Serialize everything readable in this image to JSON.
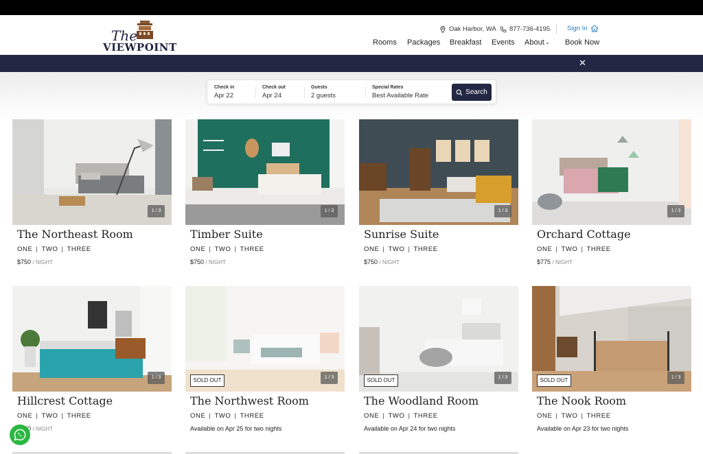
{
  "brand": {
    "script": "The",
    "name": "VIEWPOINT"
  },
  "utility": {
    "location": "Oak Harbor, WA",
    "phone": "877-736-4195",
    "signin": "Sign In"
  },
  "nav": {
    "items": [
      "Rooms",
      "Packages",
      "Breakfast",
      "Events",
      "About",
      "Book Now"
    ]
  },
  "search": {
    "checkin_label": "Check in",
    "checkin_value": "Apr 22",
    "checkout_label": "Check out",
    "checkout_value": "Apr 24",
    "guests_label": "Guests",
    "guests_value": "2 guests",
    "rates_label": "Special Rates",
    "rates_value": "Best Available Rate",
    "button": "Search"
  },
  "rooms": [
    {
      "title": "The Northeast Room",
      "opt1": "ONE",
      "opt2": "TWO",
      "opt3": "THREE",
      "price": "$750",
      "unit": "/ NIGHT",
      "counter": "1 / 3"
    },
    {
      "title": "Timber Suite",
      "opt1": "ONE",
      "opt2": "TWO",
      "opt3": "THREE",
      "price": "$750",
      "unit": "/ NIGHT",
      "counter": "1 / 3"
    },
    {
      "title": "Sunrise Suite",
      "opt1": "ONE",
      "opt2": "TWO",
      "opt3": "THREE",
      "price": "$750",
      "unit": "/ NIGHT",
      "counter": "1 / 3"
    },
    {
      "title": "Orchard Cottage",
      "opt1": "ONE",
      "opt2": "TWO",
      "opt3": "THREE",
      "price": "$775",
      "unit": "/ NIGHT",
      "counter": "1 / 3"
    },
    {
      "title": "Hillcrest Cottage",
      "opt1": "ONE",
      "opt2": "TWO",
      "opt3": "THREE",
      "price": "$750",
      "unit": "/ NIGHT",
      "counter": "1 / 3"
    },
    {
      "title": "The Northwest Room",
      "opt1": "ONE",
      "opt2": "TWO",
      "opt3": "THREE",
      "badge": "SOLD OUT",
      "availability": "Available on Apr 25 for two nights",
      "counter": "1 / 3"
    },
    {
      "title": "The Woodland Room",
      "opt1": "ONE",
      "opt2": "TWO",
      "opt3": "THREE",
      "badge": "SOLD OUT",
      "availability": "Available on Apr 24 for two nights",
      "counter": "1 / 3"
    },
    {
      "title": "The Nook Room",
      "opt1": "ONE",
      "opt2": "TWO",
      "opt3": "THREE",
      "badge": "SOLD OUT",
      "availability": "Available on Apr 23 for two nights",
      "counter": "1 / 3"
    }
  ],
  "colors": {
    "navy": "#222744",
    "link": "#2a7fbf",
    "whatsapp": "#2bb741"
  },
  "icons": {
    "location": "map-pin-icon",
    "phone": "phone-icon",
    "signin": "house-icon",
    "close": "close-icon",
    "search": "search-icon",
    "chat": "whatsapp-icon"
  }
}
